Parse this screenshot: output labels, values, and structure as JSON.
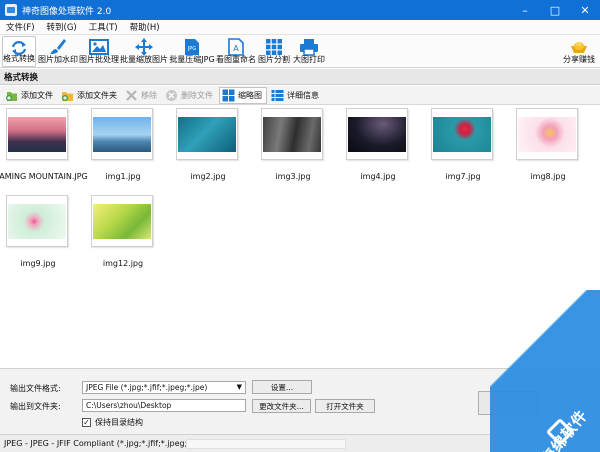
{
  "window": {
    "title": "神奇图像处理软件 2.0"
  },
  "menu": [
    "文件(F)",
    "转到(G)",
    "工具(T)",
    "帮助(H)"
  ],
  "toolbar": {
    "items": [
      {
        "label": "格式转换",
        "icon": "convert-icon"
      },
      {
        "label": "图片加水印",
        "icon": "brush-icon"
      },
      {
        "label": "图片批处理",
        "icon": "image-icon"
      },
      {
        "label": "批量缩放图片",
        "icon": "move-arrows-icon"
      },
      {
        "label": "批量压缩JPG",
        "icon": "jpg-icon"
      },
      {
        "label": "看图重命名",
        "icon": "rename-icon"
      },
      {
        "label": "图片分割",
        "icon": "grid-split-icon"
      },
      {
        "label": "大图打印",
        "icon": "printer-icon"
      }
    ],
    "share_label": "分享赚钱"
  },
  "section": {
    "title": "格式转换"
  },
  "subtoolbar": {
    "add_file": "添加文件",
    "add_folder": "添加文件夹",
    "move": "移除",
    "delete": "删除文件",
    "thumbnail": "缩略图",
    "details": "详细信息"
  },
  "files": [
    {
      "name": "FLAMING MOUNTAIN.JPG"
    },
    {
      "name": "img1.jpg"
    },
    {
      "name": "img2.jpg"
    },
    {
      "name": "img3.jpg"
    },
    {
      "name": "img4.jpg"
    },
    {
      "name": "img7.jpg"
    },
    {
      "name": "img8.jpg"
    },
    {
      "name": "img9.jpg"
    },
    {
      "name": "img12.jpg"
    }
  ],
  "output": {
    "format_label": "输出文件格式:",
    "format_value": "JPEG File (*.jpg;*.jfif;*.jpeg;*.jpe)",
    "settings_button": "设置...",
    "folder_label": "输出到文件夹:",
    "folder_value": "C:\\Users\\zhou\\Desktop",
    "change_folder_button": "更改文件夹...",
    "open_folder_button": "打开文件夹",
    "keep_structure_label": "保持目录结构"
  },
  "status": {
    "text": "JPEG - JPEG - JFIF Compliant (*.jpg;*.jfif;*.jpeg;*.jpe)"
  },
  "watermark": {
    "text": "海绵软件"
  },
  "colors": {
    "titlebar": "#1170d6",
    "accent": "#1a8be0",
    "section": "#e7e7e7"
  }
}
